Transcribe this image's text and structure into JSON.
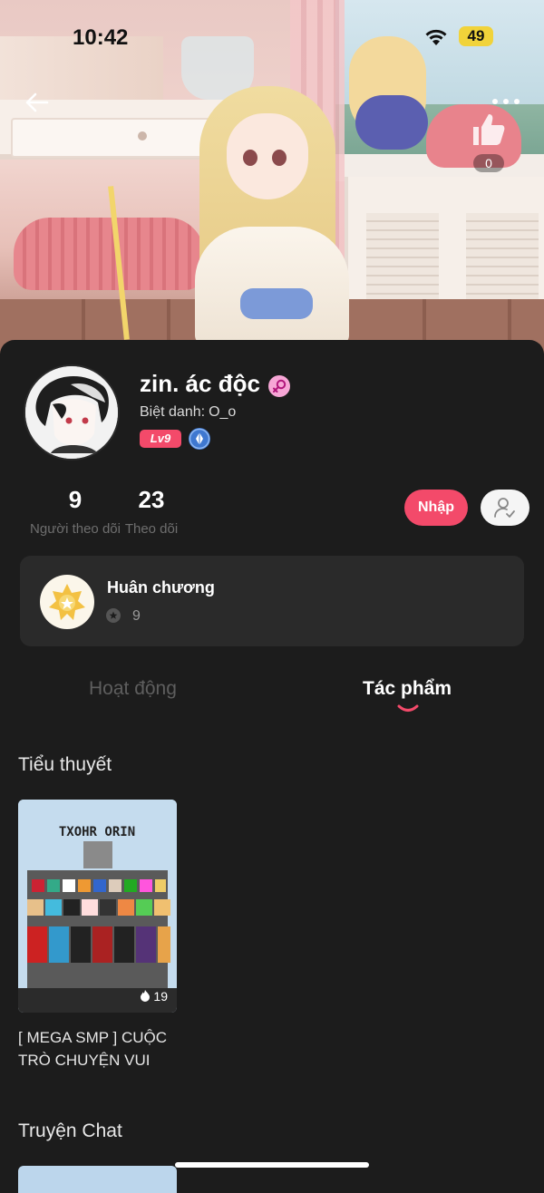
{
  "status_bar": {
    "time": "10:42",
    "battery": "49"
  },
  "banner": {
    "like_count": "0"
  },
  "profile": {
    "name": "zin. ác độc",
    "nickname_label": "Biệt danh:",
    "nickname_value": "O_o",
    "level": "Lv9"
  },
  "stats": {
    "followers": {
      "value": "9",
      "label": "Người theo dõi"
    },
    "following": {
      "value": "23",
      "label": "Theo dõi"
    }
  },
  "actions": {
    "import_label": "Nhập"
  },
  "medals": {
    "title": "Huân chương",
    "count": "9"
  },
  "tabs": [
    {
      "label": "Hoạt động",
      "active": false
    },
    {
      "label": "Tác phẩm",
      "active": true
    }
  ],
  "sections": {
    "novels": {
      "title": "Tiểu thuyết",
      "items": [
        {
          "title": "[ MEGA SMP ] CUỘC TRÒ CHUYỆN VUI",
          "fire_count": "19",
          "cover_text": "TXOHR ORIN"
        }
      ]
    },
    "chat_stories": {
      "title": "Truyện Chat"
    }
  },
  "colors": {
    "accent": "#f34a6a",
    "background": "#1c1c1c",
    "card": "#2a2a2a"
  }
}
